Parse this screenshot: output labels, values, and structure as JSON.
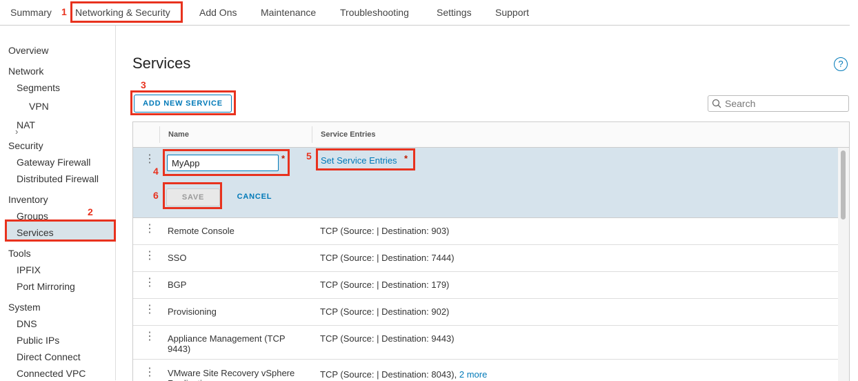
{
  "top_tabs": [
    "Summary",
    "Networking & Security",
    "Add Ons",
    "Maintenance",
    "Troubleshooting",
    "Settings",
    "Support"
  ],
  "sidebar": {
    "overview": "Overview",
    "network": "Network",
    "segments": "Segments",
    "vpn": "VPN",
    "nat": "NAT",
    "security": "Security",
    "gateway_firewall": "Gateway Firewall",
    "distributed_firewall": "Distributed Firewall",
    "inventory": "Inventory",
    "groups": "Groups",
    "services": "Services",
    "tools": "Tools",
    "ipfix": "IPFIX",
    "port_mirroring": "Port Mirroring",
    "system": "System",
    "dns": "DNS",
    "public_ips": "Public IPs",
    "direct_connect": "Direct Connect",
    "connected_vpc": "Connected VPC"
  },
  "page": {
    "title": "Services",
    "help": "?",
    "add_button": "ADD NEW SERVICE",
    "search_placeholder": "Search"
  },
  "grid": {
    "col_name": "Name",
    "col_entries": "Service Entries",
    "edit": {
      "name_value": "MyApp",
      "required_mark": "*",
      "set_entries": "Set Service Entries",
      "save": "SAVE",
      "cancel": "CANCEL"
    },
    "rows": [
      {
        "name": "Remote Console",
        "entries": "TCP (Source: | Destination: 903)",
        "more": ""
      },
      {
        "name": "SSO",
        "entries": "TCP (Source: | Destination: 7444)",
        "more": ""
      },
      {
        "name": "BGP",
        "entries": "TCP (Source: | Destination: 179)",
        "more": ""
      },
      {
        "name": "Provisioning",
        "entries": "TCP (Source: | Destination: 902)",
        "more": ""
      },
      {
        "name": "Appliance Management (TCP 9443)",
        "entries": "TCP (Source: | Destination: 9443)",
        "more": ""
      },
      {
        "name": "VMware Site Recovery vSphere Replication",
        "entries": "TCP (Source: | Destination: 8043),",
        "more": "2 more"
      }
    ]
  },
  "annotations": [
    "1",
    "2",
    "3",
    "4",
    "5",
    "6"
  ],
  "colors": {
    "accent": "#0079b8",
    "annotation": "#e8321e",
    "selected_row": "#d6e3ec"
  }
}
